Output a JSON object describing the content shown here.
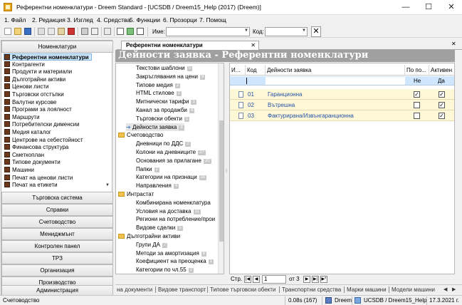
{
  "window": {
    "title": "Референтни номенклатури - Dreem Standard - [UCSDB / Dreem15_Help (2017) (Dreem)]",
    "minimize": "—",
    "maximize": "☐",
    "close": "✕"
  },
  "menu": [
    "1. Файл",
    "2. Редакция",
    "3. Изглед",
    "4. Средства",
    "5. Функции",
    "6. Прозорци",
    "7. Помощ"
  ],
  "toolbar": {
    "name_label": "Име:",
    "code_label": "Код:",
    "clear": "✕"
  },
  "sidebar": {
    "title": "Номенклатури",
    "items": [
      "Референтни номенклатури",
      "Контрагенти",
      "Продукти и материали",
      "Дълготрайни активи",
      "Ценови листи",
      "Търговски отстъпки",
      "Валутни курсове",
      "Програми за лоялност",
      "Маршрути",
      "Потребителски дименсии",
      "Медия каталог",
      "Центрове на себестойност",
      "Финансова структура",
      "Сметкоплан",
      "Типове документи",
      "Машини",
      "Печат на ценови листи",
      "Печат на етикети"
    ],
    "sections": [
      "Търговска система",
      "Справки",
      "Счетоводство",
      "Мениджмънт",
      "Контролен панел",
      "ТРЗ",
      "Организация",
      "Производство",
      "Администрация"
    ]
  },
  "tab": {
    "label": "Референтни номенклатури",
    "close": "✕"
  },
  "header": {
    "title": "Дейности заявка - Референтни номенклатури"
  },
  "tree": {
    "nodes": [
      {
        "label": "Текстови шаблони",
        "badge": "5",
        "kind": "item"
      },
      {
        "label": "Закръглявания на цени",
        "badge": "9",
        "kind": "item"
      },
      {
        "label": "Типове медия",
        "badge": "2",
        "kind": "item"
      },
      {
        "label": "HTML стилове",
        "badge": "2",
        "kind": "item"
      },
      {
        "label": "Митнически тарифи",
        "badge": "1",
        "kind": "item"
      },
      {
        "label": "Канал за продажби",
        "badge": "4",
        "kind": "item"
      },
      {
        "label": "Търговски обекти",
        "badge": "1",
        "kind": "item"
      },
      {
        "label": "Дейности заявка",
        "badge": "3",
        "kind": "current"
      },
      {
        "label": "Счетоводство",
        "badge": "",
        "kind": "folder"
      },
      {
        "label": "Дневници по ДДС",
        "badge": "2",
        "kind": "item"
      },
      {
        "label": "Колони на дневниците",
        "badge": "27",
        "kind": "item"
      },
      {
        "label": "Основания за прилагане",
        "badge": "20",
        "kind": "item"
      },
      {
        "label": "Папки",
        "badge": "2",
        "kind": "item"
      },
      {
        "label": "Категории на признаци",
        "badge": "10",
        "kind": "item"
      },
      {
        "label": "Направления",
        "badge": "4",
        "kind": "item"
      },
      {
        "label": "Интрастат",
        "badge": "",
        "kind": "folder"
      },
      {
        "label": "Комбинирана номенклатура",
        "badge": "",
        "kind": "item"
      },
      {
        "label": "Условия на доставка",
        "badge": "11",
        "kind": "item"
      },
      {
        "label": "Региони на потребление/прои",
        "badge": "",
        "kind": "item"
      },
      {
        "label": "Видове сделки",
        "badge": "5",
        "kind": "item"
      },
      {
        "label": "Дълготрайни активи",
        "badge": "",
        "kind": "folder"
      },
      {
        "label": "Групи ДА",
        "badge": "7",
        "kind": "item"
      },
      {
        "label": "Методи за амортизация",
        "badge": "6",
        "kind": "item"
      },
      {
        "label": "Коефициент на преоценка",
        "badge": "1",
        "kind": "item"
      },
      {
        "label": "Категории по чл.55",
        "badge": "2",
        "kind": "item"
      }
    ]
  },
  "grid": {
    "columns": {
      "id": "И...",
      "code": "Код",
      "name": "Дейности заявка",
      "flag1": "По по...",
      "active": "Активен"
    },
    "filter": {
      "flag1": "Не",
      "active": "Да"
    },
    "rows": [
      {
        "code": "01",
        "name": "Гаранционна",
        "flag1": true,
        "active": true
      },
      {
        "code": "02",
        "name": "Вътрешна",
        "flag1": false,
        "active": true
      },
      {
        "code": "03",
        "name": "Фактурирана/Извънгаранционна",
        "flag1": false,
        "active": true
      }
    ]
  },
  "pager": {
    "label": "Стр.",
    "page": "1",
    "of": "от 3"
  },
  "bottom_tabs": [
    "на документи",
    "Видове транспорт",
    "Типове търговски обекти",
    "Транспортни средства",
    "Марки машини",
    "Модели машини"
  ],
  "status": {
    "left": "Счетоводство",
    "timing": "0.08s (167)",
    "app": "Dreem",
    "db": "UCSDB / Dreem15_Help",
    "date": "17.3.2021 г."
  }
}
